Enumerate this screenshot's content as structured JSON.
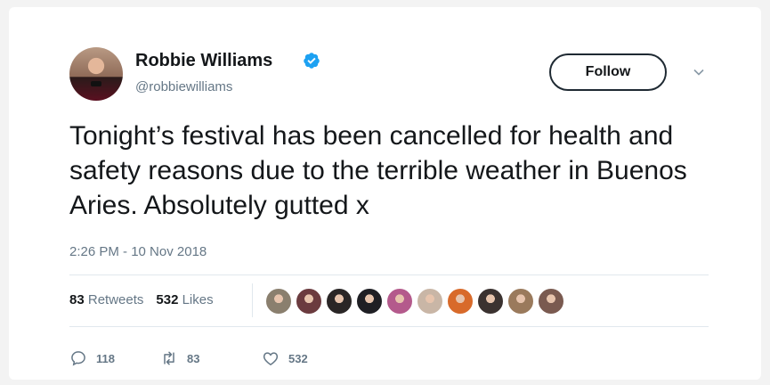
{
  "tweet": {
    "author_name": "Robbie Williams",
    "author_handle": "@robbiewilliams",
    "follow_label": "Follow",
    "text": "Tonight’s festival has been cancelled for health and safety reasons due to the terrible weather in Buenos Aries. Absolutely gutted x",
    "timestamp": "2:26 PM - 10 Nov 2018",
    "retweets_count": "83",
    "retweets_label": "Retweets",
    "likes_count": "532",
    "likes_label": "Likes",
    "replies_action_count": "118",
    "retweets_action_count": "83",
    "likes_action_count": "532"
  },
  "colors": {
    "verified": "#1da1f2",
    "secondary_text": "#657786",
    "primary_text": "#14171a"
  },
  "likers": [
    {
      "name": "liker-1",
      "color": "#8a7f6e"
    },
    {
      "name": "liker-2",
      "color": "#6b3b3f"
    },
    {
      "name": "liker-3",
      "color": "#2a2626"
    },
    {
      "name": "liker-4",
      "color": "#1f1f24"
    },
    {
      "name": "liker-5",
      "color": "#b45a8c"
    },
    {
      "name": "liker-6",
      "color": "#c9b6a6"
    },
    {
      "name": "liker-7",
      "color": "#d86a2a"
    },
    {
      "name": "liker-8",
      "color": "#3b3230"
    },
    {
      "name": "liker-9",
      "color": "#9a7a5c"
    },
    {
      "name": "liker-10",
      "color": "#7a5a50"
    }
  ]
}
